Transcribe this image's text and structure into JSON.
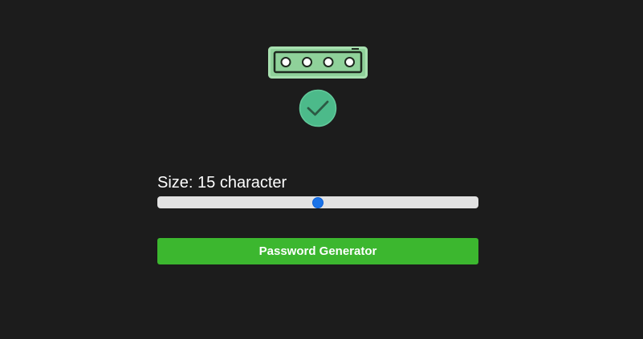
{
  "logo": {
    "icon": "password-field-icon",
    "dots": 4,
    "color": "#8fd19a"
  },
  "status": {
    "icon": "check-circle-icon",
    "color": "#4cba8a"
  },
  "size": {
    "label": "Size: 15 character",
    "slider_value_fraction": 0.5,
    "track_color": "#e2e2e2",
    "thumb_color": "#1a73e8"
  },
  "generate": {
    "label": "Password Generator",
    "color": "#3cb72f"
  },
  "page": {
    "background": "#1c1c1c"
  }
}
